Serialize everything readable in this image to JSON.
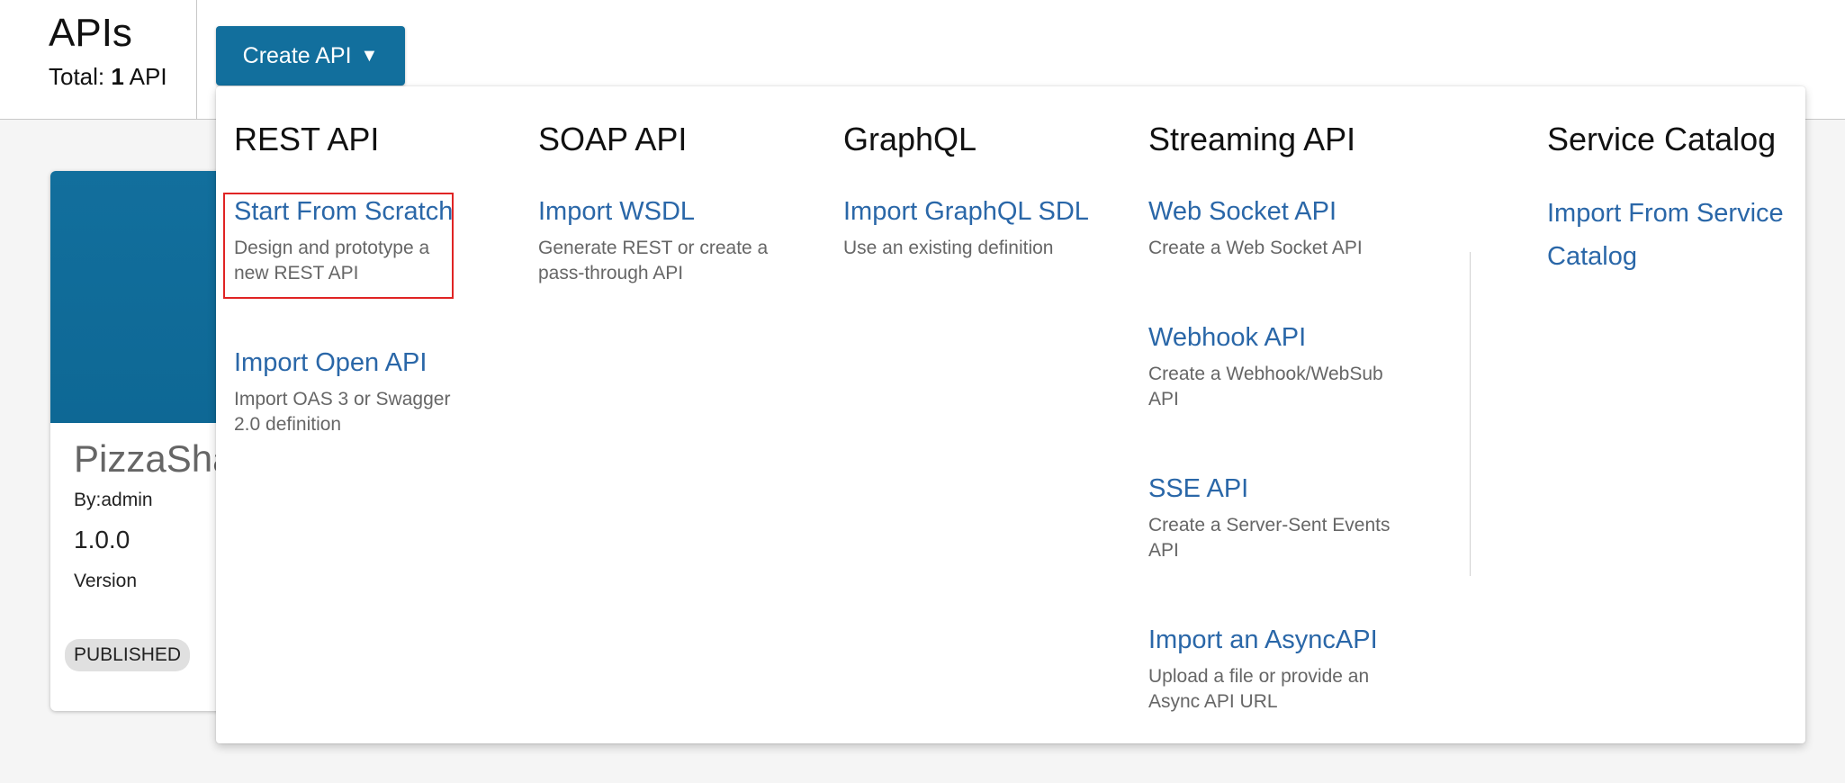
{
  "header": {
    "title": "APIs",
    "total_label": "Total:",
    "total_count": "1",
    "total_unit": "API"
  },
  "create_button": {
    "label": "Create API",
    "caret": "▼"
  },
  "card": {
    "name": "PizzaSha",
    "by": "By:admin",
    "version": "1.0.0",
    "version_label": "Version",
    "status": "PUBLISHED"
  },
  "dropdown": {
    "rest": {
      "title": "REST API",
      "items": [
        {
          "label": "Start From Scratch",
          "desc": "Design and prototype a new REST API"
        },
        {
          "label": "Import Open API",
          "desc": "Import OAS 3 or Swagger 2.0 definition"
        }
      ]
    },
    "soap": {
      "title": "SOAP API",
      "items": [
        {
          "label": "Import WSDL",
          "desc": "Generate REST or create a pass-through API"
        }
      ]
    },
    "graphql": {
      "title": "GraphQL",
      "items": [
        {
          "label": "Import GraphQL SDL",
          "desc": "Use an existing definition"
        }
      ]
    },
    "streaming": {
      "title": "Streaming API",
      "items": [
        {
          "label": "Web Socket API",
          "desc": "Create a Web Socket API"
        },
        {
          "label": "Webhook API",
          "desc": "Create a Webhook/WebSub API"
        },
        {
          "label": "SSE API",
          "desc": "Create a Server-Sent Events API"
        },
        {
          "label": "Import an AsyncAPI",
          "desc": "Upload a file or provide an Async API URL"
        }
      ]
    },
    "service_catalog": {
      "title": "Service Catalog",
      "items": [
        {
          "label": "Import From Service Catalog"
        }
      ]
    }
  },
  "colors": {
    "primary": "#126f9d",
    "link": "#2a67a8",
    "highlight": "#e02424"
  }
}
